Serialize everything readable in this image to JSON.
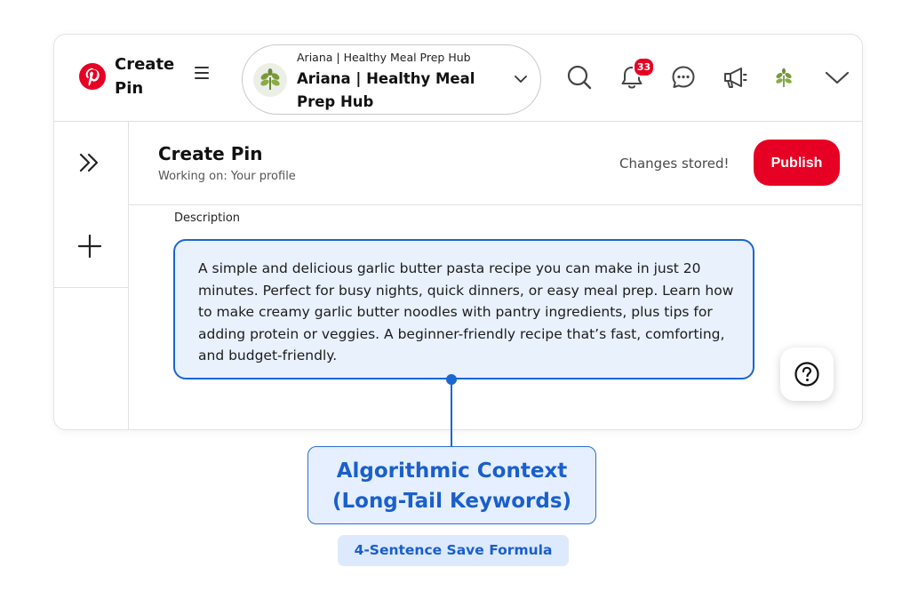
{
  "topbar": {
    "brand_title": "Create Pin",
    "account": {
      "small_name": "Ariana | Healthy Meal Prep Hub",
      "name": "Ariana | Healthy Meal Prep Hub"
    },
    "notification_count": "33",
    "icons": [
      "pinterest-logo",
      "menu-icon",
      "chevron-down-icon",
      "search-icon",
      "bell-icon",
      "chat-icon",
      "megaphone-icon",
      "avatar",
      "chevron-down-icon"
    ]
  },
  "header": {
    "title": "Create Pin",
    "subtitle": "Working on: Your profile",
    "status": "Changes stored!",
    "publish_label": "Publish"
  },
  "form": {
    "description_label": "Description",
    "description_value": "A simple and delicious garlic butter pasta recipe you can make in just 20 minutes. Perfect for busy nights, quick dinners, or easy meal prep. Learn how to make creamy garlic butter noodles with pantry ingredients, plus tips for adding protein or veggies. A beginner-friendly recipe that’s fast, comforting, and budget-friendly."
  },
  "annotation": {
    "callout": "Algorithmic Context (Long-Tail Keywords)",
    "formula": "4-Sentence Save Formula"
  },
  "colors": {
    "brand_red": "#e60023",
    "accent_blue": "#1a66d2",
    "callout_fill": "#e5efff"
  }
}
